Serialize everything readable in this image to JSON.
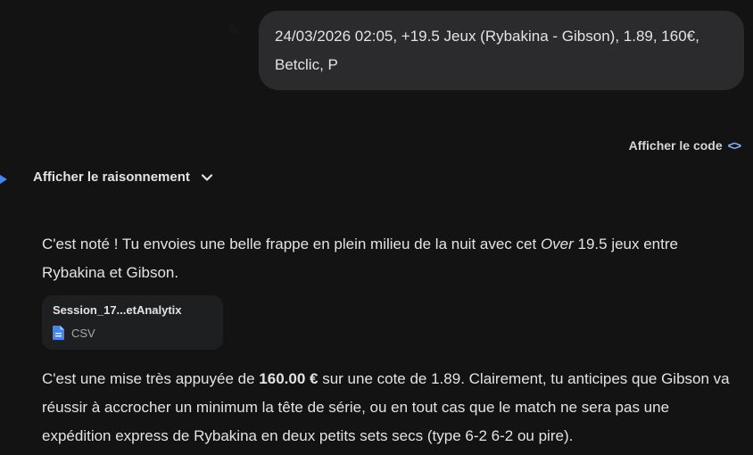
{
  "user_message": {
    "text_line1": "24/03/2026 02:05, +19.5 Jeux (Rybakina - Gibson), 1.89, 160€,",
    "text_line2": "Betclic, P"
  },
  "response": {
    "show_code_label": "Afficher le code",
    "show_code_icon": "code-icon",
    "reasoning_label": "Afficher le raisonnement",
    "para1": {
      "part1": "C'est noté ! Tu envoies une belle frappe en plein milieu de la nuit avec cet ",
      "italic": "Over",
      "part2": " 19.5 jeux entre Rybakina et Gibson."
    },
    "attachment": {
      "name": "Session_17...etAnalytix",
      "type": "CSV"
    },
    "para2": {
      "part1": "C'est une mise très appuyée de ",
      "bold": "160.00 €",
      "part2": " sur une cote de 1.89. Clairement, tu anticipes que Gibson va réussir à accrocher un minimum la tête de série, ou en tout cas que le match ne sera pas une expédition express de Rybakina en deux petits sets secs (type 6-2 6-2 ou pire)."
    }
  },
  "colors": {
    "background": "#131314",
    "bubble": "#2b2b2e",
    "card": "#1e1f20",
    "accent_blue": "#8ab4f8",
    "doc_blue": "#4285f4"
  }
}
